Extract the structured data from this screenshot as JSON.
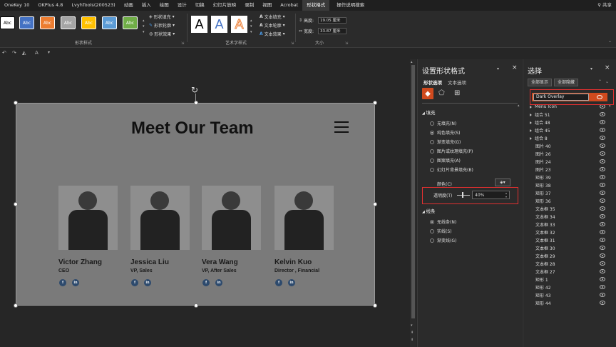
{
  "menubar": {
    "items": [
      "OneKey 10",
      "OKPlus 4.8",
      "LvyhTools(200523)",
      "动画",
      "插入",
      "绘图",
      "设计",
      "切换",
      "幻灯片放映",
      "录制",
      "视图",
      "Acrobat",
      "形状格式",
      "操作说明搜索"
    ],
    "active_index": 12,
    "share": "共享"
  },
  "ribbon": {
    "shape_styles": {
      "swatches": [
        {
          "label": "Abc",
          "bg": "#ffffff",
          "fg": "#000000"
        },
        {
          "label": "Abc",
          "bg": "#4472c4",
          "fg": "#ffffff"
        },
        {
          "label": "Abc",
          "bg": "#ed7d31",
          "fg": "#ffffff"
        },
        {
          "label": "Abc",
          "bg": "#a5a5a5",
          "fg": "#ffffff"
        },
        {
          "label": "Abc",
          "bg": "#ffc000",
          "fg": "#ffffff"
        },
        {
          "label": "Abc",
          "bg": "#5b9bd5",
          "fg": "#ffffff"
        },
        {
          "label": "Abc",
          "bg": "#70ad47",
          "fg": "#ffffff"
        }
      ],
      "fill": "形状填充",
      "outline": "形状轮廓",
      "effects": "形状效果",
      "group": "形状样式"
    },
    "wordart": {
      "letters": [
        "A",
        "A",
        "A"
      ],
      "fill": "文本填充",
      "outline": "文本轮廓",
      "effects": "文本效果",
      "group": "艺术字样式"
    },
    "size": {
      "height_label": "高度:",
      "height": "19.05 厘米",
      "width_label": "宽度:",
      "width": "33.87 厘米",
      "group": "大小"
    }
  },
  "slide": {
    "title": "Meet Our Team",
    "team": [
      {
        "name": "Victor Zhang",
        "role": "CEO"
      },
      {
        "name": "Jessica Liu",
        "role": "VP, Sales"
      },
      {
        "name": "Vera Wang",
        "role": "VP, After Sales"
      },
      {
        "name": "Kelvin Kuo",
        "role": "Director , Financial"
      }
    ],
    "social": [
      "f",
      "in"
    ]
  },
  "format_pane": {
    "title": "设置形状格式",
    "tab_shape": "形状选项",
    "tab_text": "文本选项",
    "fill_section": "填充",
    "fill_options": [
      "无填充(N)",
      "纯色填充(S)",
      "渐变填充(G)",
      "图片或纹理填充(P)",
      "图案填充(A)",
      "幻灯片背景填充(B)"
    ],
    "fill_selected": 1,
    "color_label": "颜色(C)",
    "transparency_label": "透明度(T)",
    "transparency_value": "40%",
    "line_section": "线条",
    "line_options": [
      "无线条(N)",
      "实线(S)",
      "渐变线(G)"
    ],
    "line_selected": 0
  },
  "selection_pane": {
    "title": "选择",
    "show_all": "全部显示",
    "hide_all": "全部隐藏",
    "selected_item": "Dark Overlay",
    "items": [
      {
        "label": "Menu Icon",
        "group": true
      },
      {
        "label": "组合 51",
        "group": true
      },
      {
        "label": "组合 48",
        "group": true
      },
      {
        "label": "组合 45",
        "group": true
      },
      {
        "label": "组合 8",
        "group": true
      },
      {
        "label": "图片 40",
        "group": false
      },
      {
        "label": "图片 26",
        "group": false
      },
      {
        "label": "图片 24",
        "group": false
      },
      {
        "label": "图片 23",
        "group": false
      },
      {
        "label": "矩形 39",
        "group": false
      },
      {
        "label": "矩形 38",
        "group": false
      },
      {
        "label": "矩形 37",
        "group": false
      },
      {
        "label": "矩形 36",
        "group": false
      },
      {
        "label": "文本框 35",
        "group": false
      },
      {
        "label": "文本框 34",
        "group": false
      },
      {
        "label": "文本框 33",
        "group": false
      },
      {
        "label": "文本框 32",
        "group": false
      },
      {
        "label": "文本框 31",
        "group": false
      },
      {
        "label": "文本框 30",
        "group": false
      },
      {
        "label": "文本框 29",
        "group": false
      },
      {
        "label": "文本框 28",
        "group": false
      },
      {
        "label": "文本框 27",
        "group": false
      },
      {
        "label": "矩形 1",
        "group": false
      },
      {
        "label": "矩形 42",
        "group": false
      },
      {
        "label": "矩形 43",
        "group": false
      },
      {
        "label": "矩形 44",
        "group": false
      }
    ]
  },
  "colors": {
    "accent_selected": "#d04a1e",
    "highlight_box": "#e03030",
    "overlay": "#7a7a7a"
  }
}
